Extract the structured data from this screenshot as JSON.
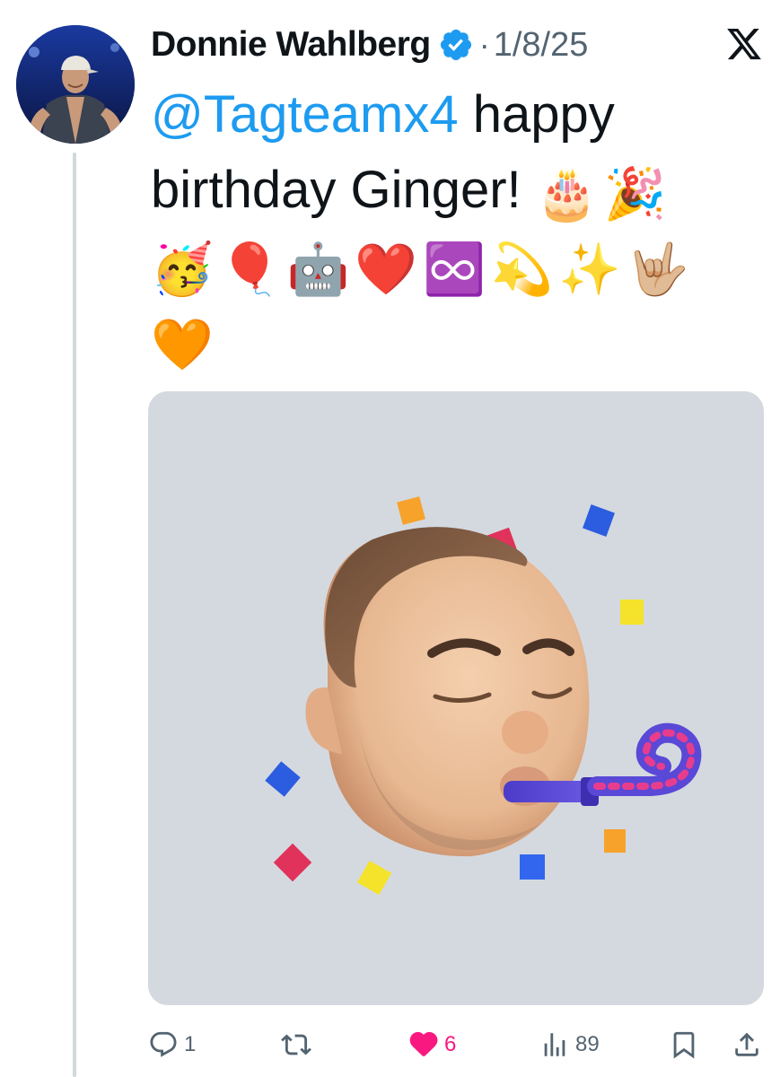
{
  "author": {
    "display_name": "Donnie Wahlberg",
    "verified": true,
    "separator": "·",
    "date": "1/8/25"
  },
  "platform_icon": "x-logo-icon",
  "tweet": {
    "mention": "@Tagteamx4",
    "text_line1_rest": " happy",
    "text_line2": "birthday Ginger!",
    "emojis_line2": [
      "🎂",
      "🎉"
    ],
    "emojis_line3": [
      "🥳",
      "🎈",
      "🤖",
      "❤️",
      "♾️",
      "💫",
      "✨",
      "🤟🏼"
    ],
    "emojis_line4": [
      "🧡"
    ]
  },
  "media": {
    "description_icon": "memoji-party-blower-image",
    "background": "#d4d9e0"
  },
  "actions": {
    "reply_count": "1",
    "retweet_count": "",
    "like_count": "6",
    "views_count": "89"
  },
  "colors": {
    "accent": "#1d9bf0",
    "like": "#f91880",
    "muted": "#536471"
  }
}
